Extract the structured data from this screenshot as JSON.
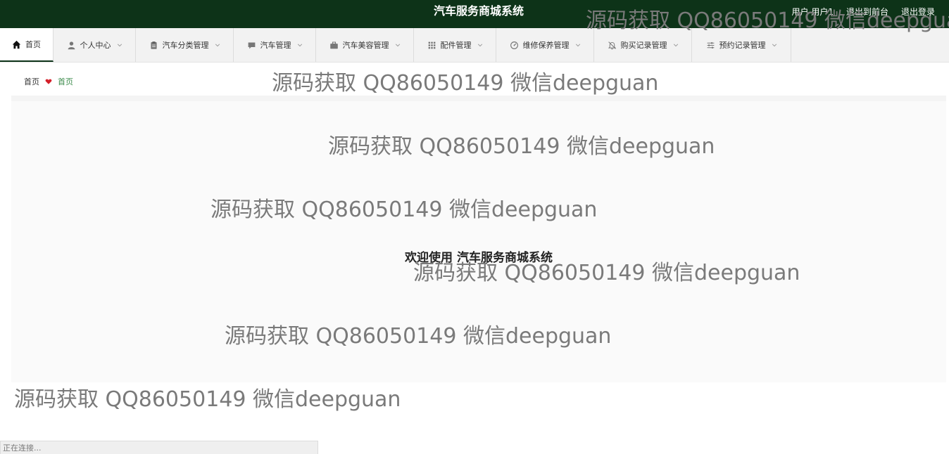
{
  "header": {
    "app_title": "汽车服务商城系统",
    "user_label": "用户",
    "user_name": "用户1",
    "back_to_front": "退出到前台",
    "logout": "退出登录"
  },
  "nav": {
    "items": [
      {
        "label": "首页",
        "icon": "home-icon"
      },
      {
        "label": "个人中心",
        "icon": "user-icon"
      },
      {
        "label": "汽车分类管理",
        "icon": "clipboard-icon"
      },
      {
        "label": "汽车管理",
        "icon": "chat-icon"
      },
      {
        "label": "汽车美容管理",
        "icon": "briefcase-icon"
      },
      {
        "label": "配件管理",
        "icon": "grid-icon"
      },
      {
        "label": "维修保养管理",
        "icon": "gauge-icon"
      },
      {
        "label": "购买记录管理",
        "icon": "bell-off-icon"
      },
      {
        "label": "预约记录管理",
        "icon": "sliders-icon"
      }
    ]
  },
  "breadcrumb": {
    "home": "首页",
    "current": "首页",
    "separator_icon": "heart-icon"
  },
  "main": {
    "welcome": "欢迎使用 汽车服务商城系统"
  },
  "watermark": {
    "text": "源码获取 QQ86050149 微信deepguan"
  },
  "status": {
    "text": "正在连接..."
  },
  "colors": {
    "header_bg": "#0d3318",
    "breadcrumb_current": "#3a8a4a",
    "heart": "#d4202a"
  }
}
